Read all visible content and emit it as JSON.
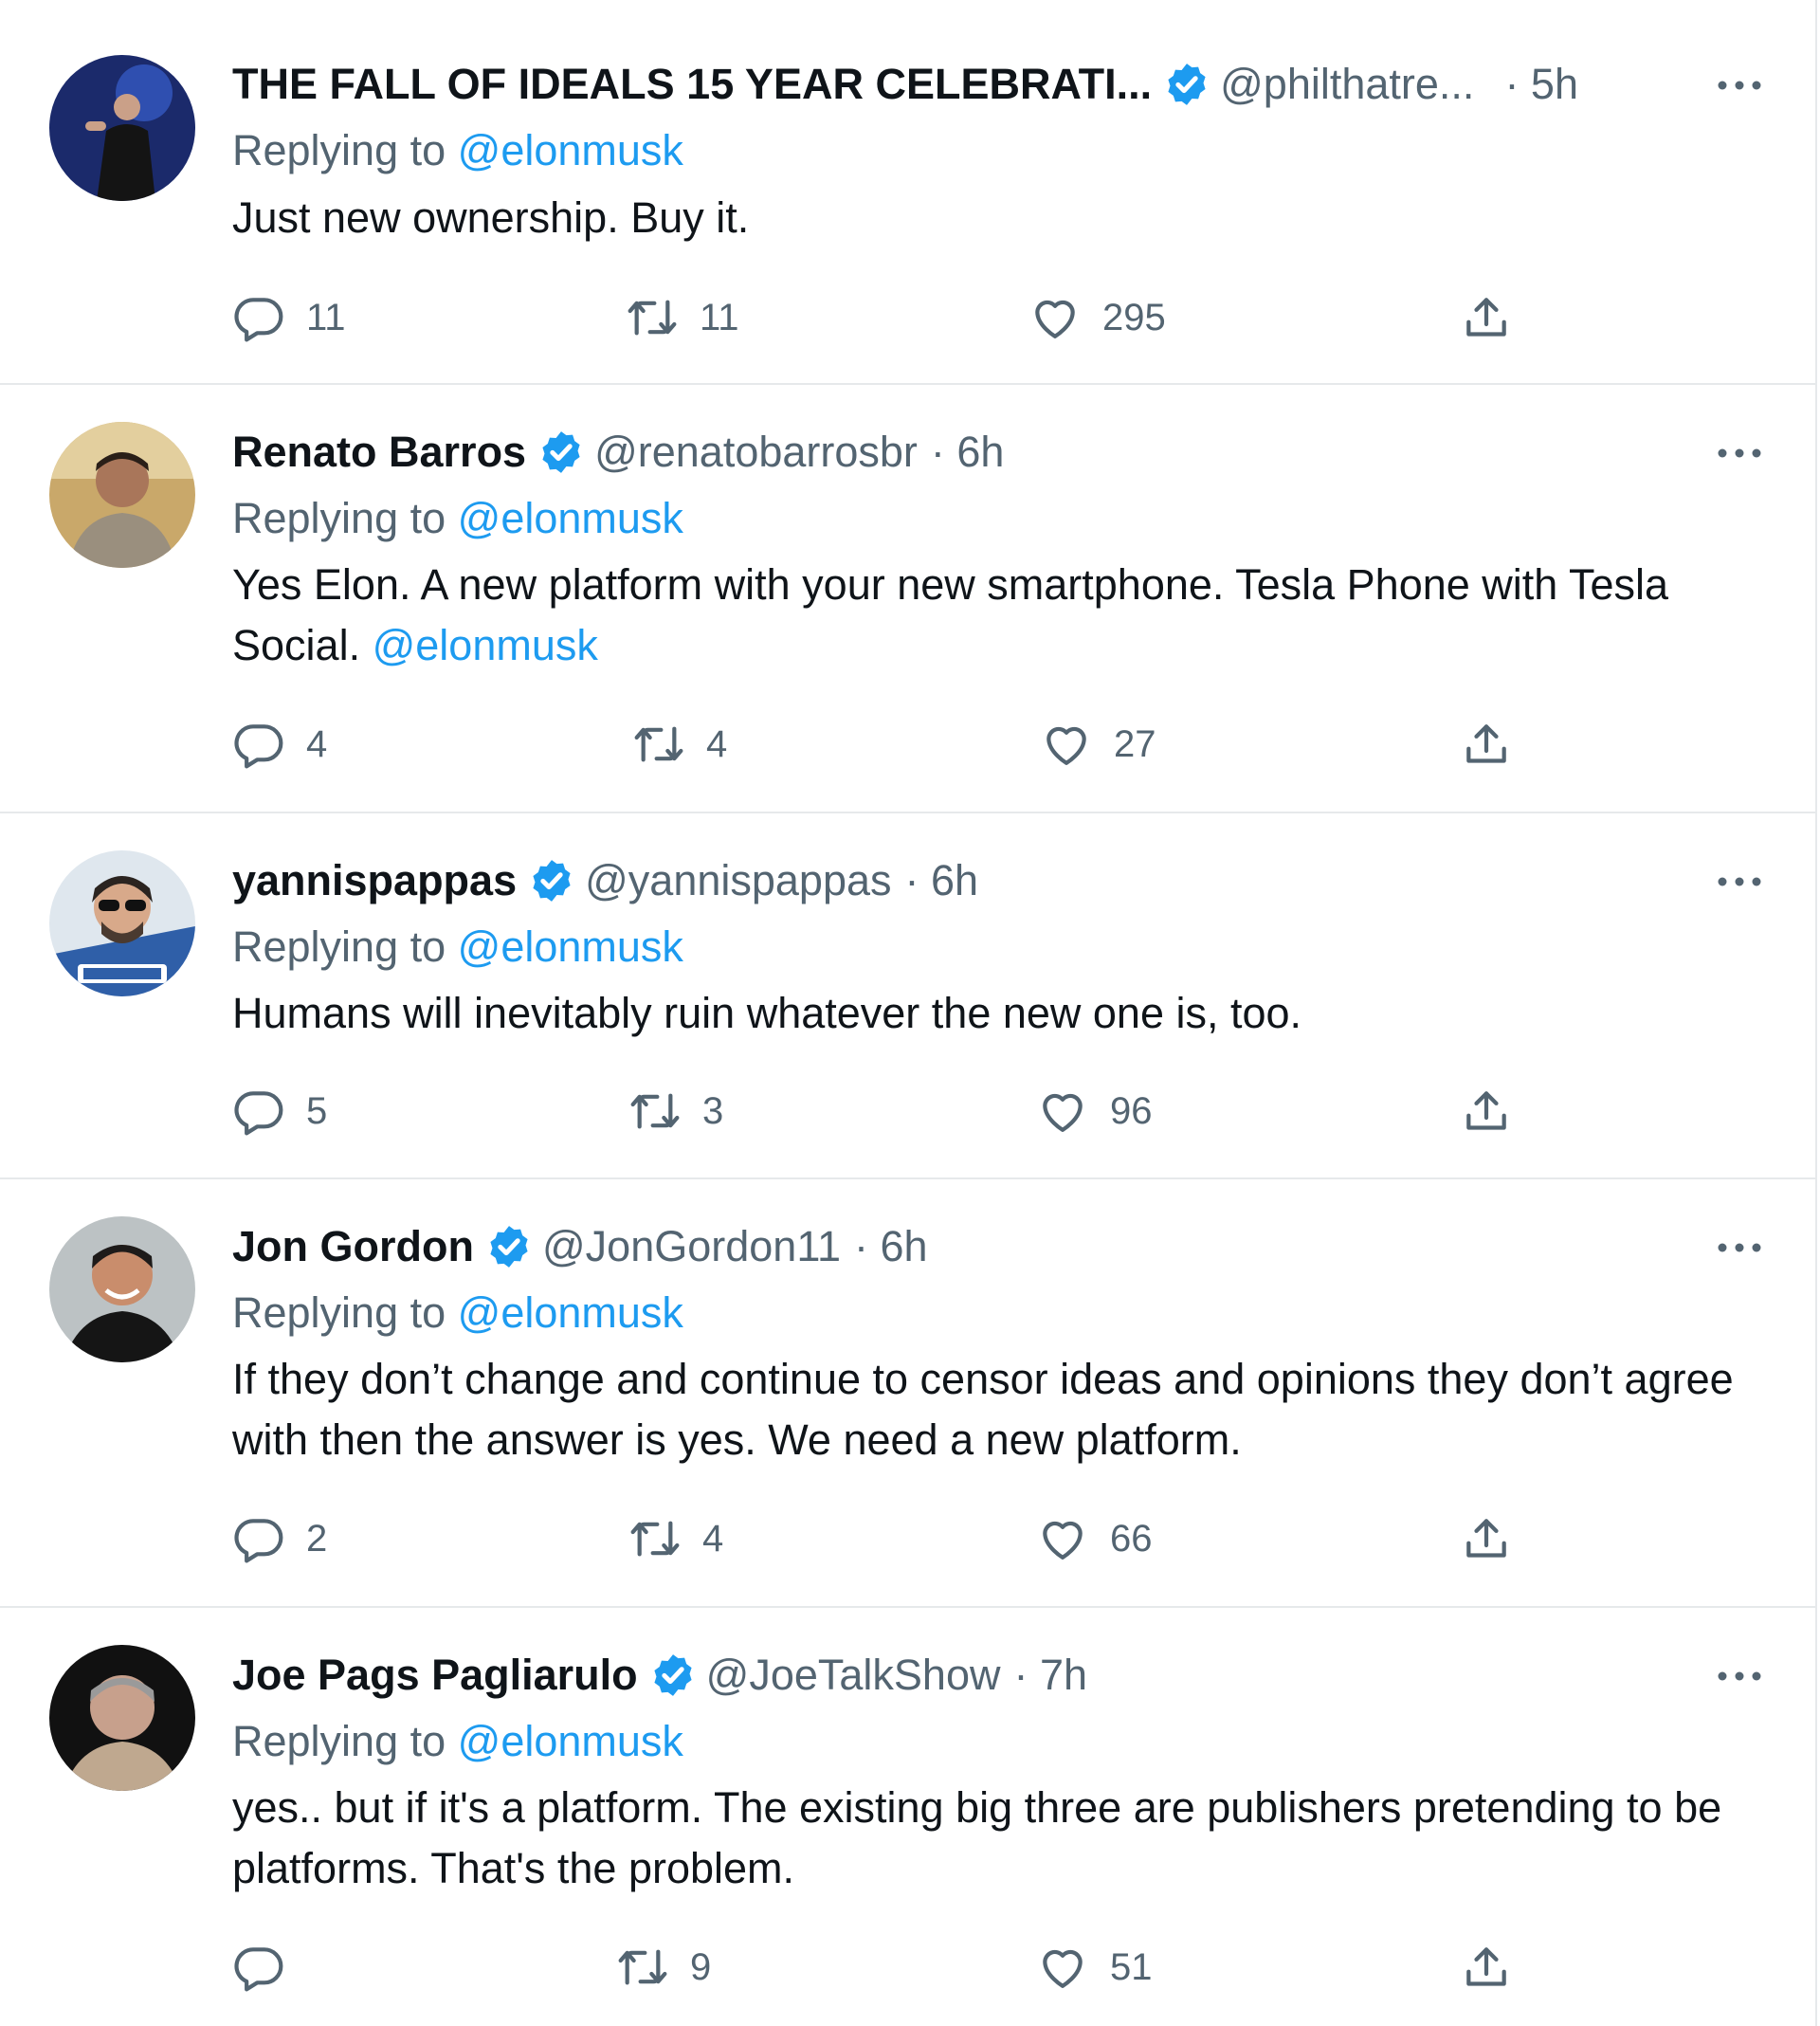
{
  "colors": {
    "accent": "#1d9bf0",
    "text": "#0f1419",
    "secondary": "#536471",
    "divider": "#e6e9eb"
  },
  "replying_label": "Replying to",
  "tweets": [
    {
      "name": "THE FALL OF IDEALS 15 YEAR CELEBRATI...",
      "handle": "@philthatre...",
      "time": "· 5h",
      "replying_to": "@elonmusk",
      "text": "Just new ownership. Buy it.",
      "text_mention": "",
      "verified": true,
      "avatar_icon": "avatar-photo",
      "stats": {
        "replies": "11",
        "retweets": "11",
        "likes": "295"
      }
    },
    {
      "name": "Renato Barros",
      "handle": "@renatobarrosbr",
      "time": "· 6h",
      "replying_to": "@elonmusk",
      "text": "Yes Elon. A new platform with your new smartphone. Tesla Phone with Tesla Social.",
      "text_mention": "@elonmusk",
      "verified": true,
      "avatar_icon": "avatar-photo",
      "stats": {
        "replies": "4",
        "retweets": "4",
        "likes": "27"
      }
    },
    {
      "name": "yannispappas",
      "handle": "@yannispappas",
      "time": "· 6h",
      "replying_to": "@elonmusk",
      "text": "Humans will inevitably ruin whatever the new one is, too.",
      "text_mention": "",
      "verified": true,
      "avatar_icon": "avatar-cartoon",
      "stats": {
        "replies": "5",
        "retweets": "3",
        "likes": "96"
      }
    },
    {
      "name": "Jon Gordon",
      "handle": "@JonGordon11",
      "time": "· 6h",
      "replying_to": "@elonmusk",
      "text": "If they don’t change and continue to censor ideas and opinions they don’t agree with then the answer is yes. We need a new platform.",
      "text_mention": "",
      "verified": true,
      "avatar_icon": "avatar-photo",
      "stats": {
        "replies": "2",
        "retweets": "4",
        "likes": "66"
      }
    },
    {
      "name": "Joe Pags Pagliarulo",
      "handle": "@JoeTalkShow",
      "time": "· 7h",
      "replying_to": "@elonmusk",
      "text": "yes.. but if it's a platform.  The existing big three are publishers pretending to be platforms.  That's the problem.",
      "text_mention": "",
      "verified": true,
      "avatar_icon": "avatar-photo",
      "stats": {
        "replies": "",
        "retweets": "9",
        "likes": "51"
      }
    }
  ]
}
